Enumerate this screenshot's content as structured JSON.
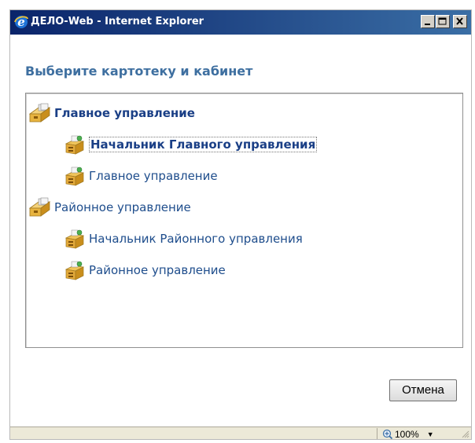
{
  "window": {
    "title": "ДЕЛО-Web - Internet Explorer",
    "controls": {
      "minimize": "_",
      "maximize": "□",
      "close": "X"
    }
  },
  "dialog": {
    "heading": "Выберите картотеку и кабинет",
    "tree": [
      {
        "label": "Главное управление",
        "level": 0,
        "bold": true,
        "icon": "card-index-icon",
        "children": [
          {
            "label": "Начальник Главного управления",
            "level": 1,
            "selected": true,
            "icon": "cabinet-icon"
          },
          {
            "label": "Главное управление",
            "level": 1,
            "icon": "cabinet-icon"
          }
        ]
      },
      {
        "label": "Районное управление",
        "level": 0,
        "icon": "card-index-icon",
        "children": [
          {
            "label": "Начальник Районного управления",
            "level": 1,
            "icon": "cabinet-icon"
          },
          {
            "label": "Районное управление",
            "level": 1,
            "icon": "cabinet-icon"
          }
        ]
      }
    ],
    "cancel_label": "Отмена"
  },
  "statusbar": {
    "zoom": "100%"
  },
  "colors": {
    "heading": "#3e6fa0",
    "link": "#1e4d8c",
    "titlebar_start": "#0a246a",
    "titlebar_end": "#3a6ea5"
  }
}
